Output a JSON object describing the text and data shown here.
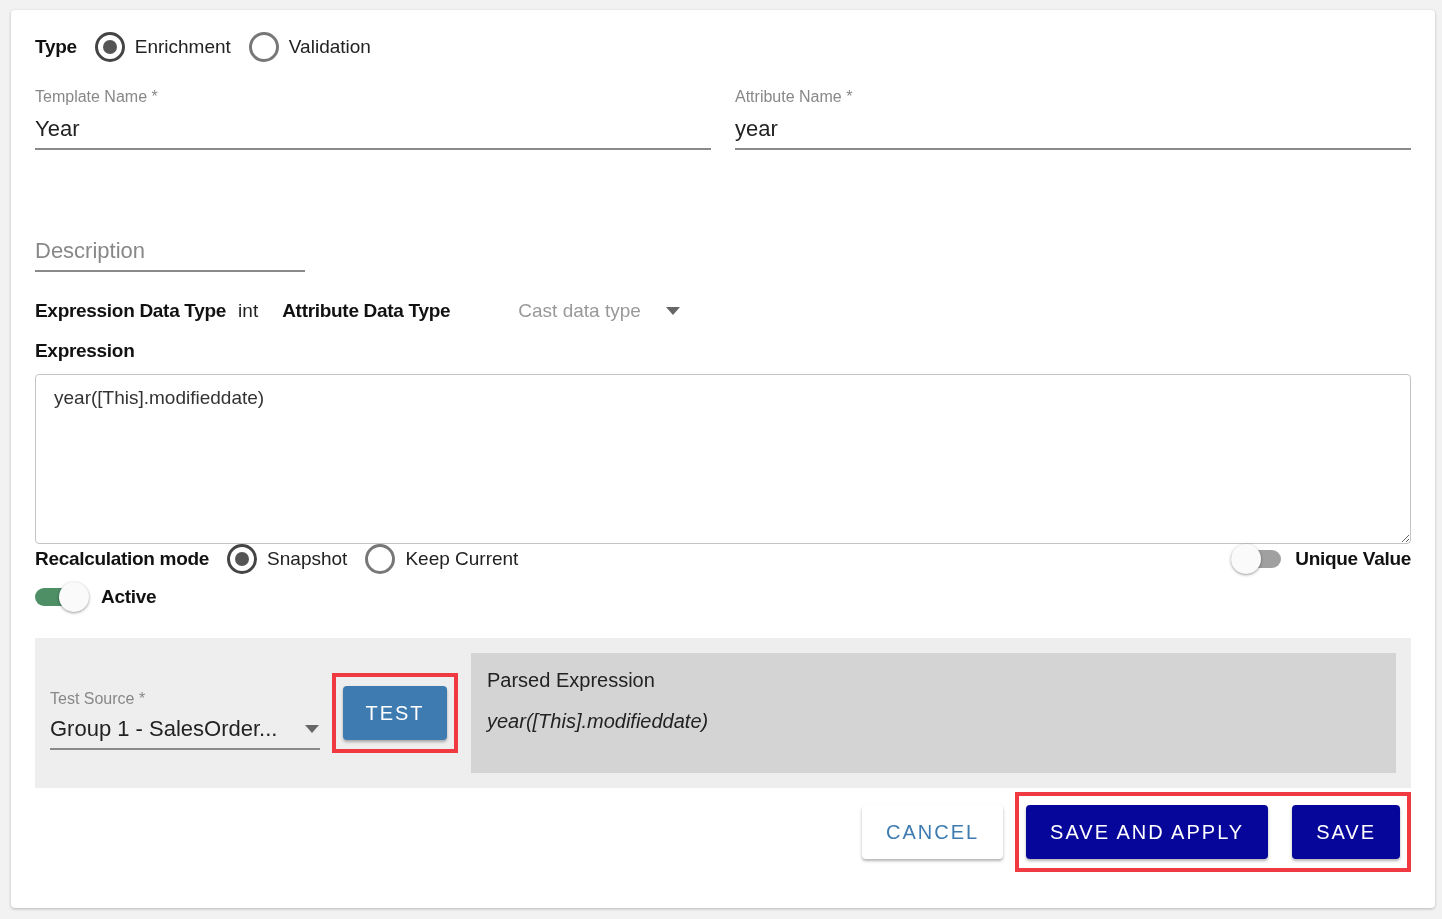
{
  "type_field": {
    "label": "Type",
    "options": [
      {
        "label": "Enrichment",
        "selected": true
      },
      {
        "label": "Validation",
        "selected": false
      }
    ]
  },
  "template_name": {
    "label": "Template Name *",
    "value": "Year"
  },
  "attribute_name": {
    "label": "Attribute Name *",
    "value": "year"
  },
  "description": {
    "placeholder": "Description"
  },
  "expression_data_type": {
    "label": "Expression Data Type",
    "value": "int"
  },
  "attribute_data_type": {
    "label": "Attribute Data Type",
    "placeholder": "Cast data type"
  },
  "expression": {
    "label": "Expression",
    "value": "year([This].modifieddate)"
  },
  "recalculation_mode": {
    "label": "Recalculation mode",
    "options": [
      {
        "label": "Snapshot",
        "selected": true
      },
      {
        "label": "Keep Current",
        "selected": false
      }
    ]
  },
  "unique_value": {
    "label": "Unique Value",
    "on": false
  },
  "active": {
    "label": "Active",
    "on": true
  },
  "test_source": {
    "label": "Test Source *",
    "value": "Group 1 - SalesOrder..."
  },
  "test_button": {
    "label": "TEST",
    "highlighted": true
  },
  "parsed_expression": {
    "title": "Parsed Expression",
    "value": "year([This].modifieddate)"
  },
  "footer_buttons": [
    {
      "label": "CANCEL",
      "kind": "outlined",
      "highlighted": false
    },
    {
      "label": "SAVE AND APPLY",
      "kind": "primary",
      "highlighted": true
    },
    {
      "label": "SAVE",
      "kind": "primary",
      "highlighted": true
    }
  ]
}
